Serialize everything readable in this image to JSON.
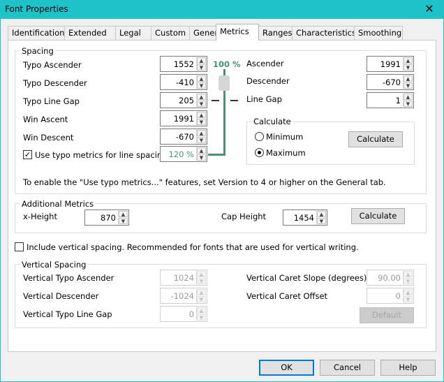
{
  "window": {
    "title": "Font Properties",
    "close_label": "✕"
  },
  "tabs": [
    {
      "label": "Identification"
    },
    {
      "label": "Extended"
    },
    {
      "label": "Legal"
    },
    {
      "label": "Custom"
    },
    {
      "label": "General"
    },
    {
      "label": "Metrics",
      "active": true
    },
    {
      "label": "Ranges"
    },
    {
      "label": "Characteristics"
    },
    {
      "label": "Smoothing"
    }
  ],
  "spacing": {
    "title": "Spacing",
    "typo_ascender": {
      "label": "Typo Ascender",
      "accel": "A",
      "value": "1552"
    },
    "typo_descender": {
      "label": "Typo Descender",
      "accel": "e",
      "value": "-410"
    },
    "typo_line_gap": {
      "label": "Typo Line Gap",
      "accel": "L",
      "value": "205"
    },
    "win_ascent": {
      "label": "Win Ascent",
      "accel": "W",
      "value": "1991"
    },
    "win_descent": {
      "label": "Win Descent",
      "accel": "n",
      "value": "-670"
    },
    "use_typo": {
      "label": "Use typo metrics for line spacing",
      "accel": "U",
      "checked": true,
      "value": "120 %"
    },
    "scale_label": "100 %",
    "ascender": {
      "label": "Ascender",
      "accel": "c",
      "value": "1991"
    },
    "descender": {
      "label": "Descender",
      "accel": "D",
      "value": "-670"
    },
    "line_gap": {
      "label": "Line Gap",
      "accel": "G",
      "value": "1"
    },
    "calculate": {
      "title": "Calculate",
      "minimum": "Minimum",
      "maximum": "Maximum",
      "selected": "Maximum",
      "button": "Calculate"
    },
    "note": "To enable the \"Use typo metrics...\" features, set Version to 4 or higher on the General tab."
  },
  "additional": {
    "title": "Additional Metrics",
    "x_height": {
      "label": "x-Height",
      "value": "870"
    },
    "cap_height": {
      "label": "Cap Height",
      "value": "1454"
    },
    "button": "Calculate"
  },
  "vertical_checkbox": {
    "label": "Include vertical spacing. Recommended for fonts that are used for vertical writing.",
    "checked": false
  },
  "vertical": {
    "title": "Vertical Spacing",
    "typo_ascender": {
      "label": "Vertical Typo Ascender",
      "value": "1024"
    },
    "descender": {
      "label": "Vertical Descender",
      "value": "-1024"
    },
    "typo_line_gap": {
      "label": "Vertical Typo Line Gap",
      "value": "0"
    },
    "caret_slope": {
      "label": "Vertical Caret Slope (degrees)",
      "value": "90.00"
    },
    "caret_offset": {
      "label": "Vertical Caret Offset",
      "value": "0"
    },
    "default_button": "Default"
  },
  "footer": {
    "ok": "OK",
    "cancel": "Cancel",
    "help": "Help"
  },
  "colors": {
    "titlebar": "#1ec2c9",
    "accent": "#0078d7",
    "metric_line": "#4a8f7c"
  }
}
